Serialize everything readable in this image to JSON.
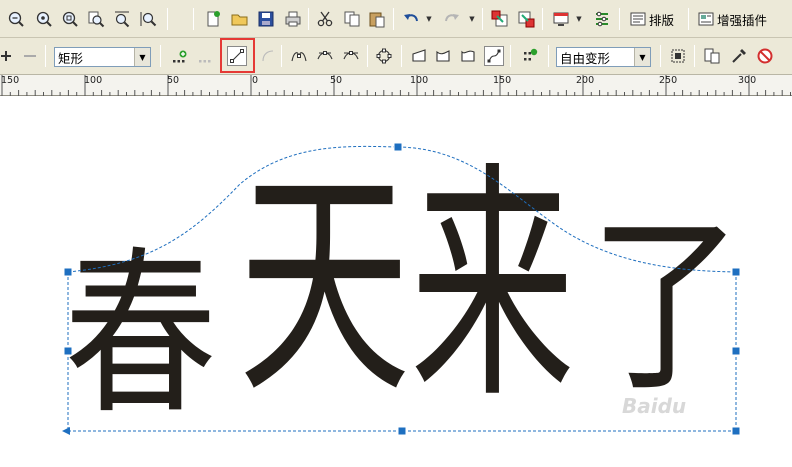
{
  "toolbar_standard": {
    "buttons": [
      {
        "name": "zoom-out-icon"
      },
      {
        "name": "zoom-to-selected-icon"
      },
      {
        "name": "zoom-to-all-icon"
      },
      {
        "name": "zoom-to-page-icon"
      },
      {
        "name": "zoom-to-page-width-icon"
      },
      {
        "name": "zoom-to-page-height-icon"
      },
      {
        "name": "new-document-icon"
      },
      {
        "name": "open-icon"
      },
      {
        "name": "save-icon"
      },
      {
        "name": "print-icon"
      },
      {
        "name": "cut-icon"
      },
      {
        "name": "copy-icon"
      },
      {
        "name": "paste-icon"
      },
      {
        "name": "undo-icon"
      },
      {
        "name": "redo-icon"
      },
      {
        "name": "import-icon"
      },
      {
        "name": "export-icon"
      },
      {
        "name": "application-launcher-icon"
      },
      {
        "name": "options-icon"
      }
    ],
    "layout_label": "排版",
    "plugin_label": "增强插件"
  },
  "property_bar": {
    "shape_combo_value": "矩形",
    "transform_combo_value": "自由变形",
    "buttons": [
      {
        "name": "add-node-icon"
      },
      {
        "name": "delete-node-icon"
      },
      {
        "name": "join-nodes-icon"
      },
      {
        "name": "break-curve-icon"
      },
      {
        "name": "to-line-icon"
      },
      {
        "name": "to-curve-icon"
      },
      {
        "name": "cusp-node-icon"
      },
      {
        "name": "smooth-node-icon"
      },
      {
        "name": "symmetrical-node-icon"
      },
      {
        "name": "reverse-direction-icon"
      },
      {
        "name": "extract-subpath-icon"
      },
      {
        "name": "stretch-nodes-icon"
      },
      {
        "name": "rotate-nodes-icon"
      },
      {
        "name": "align-nodes-icon"
      },
      {
        "name": "envelope-straight-line-icon"
      },
      {
        "name": "envelope-single-arc-icon"
      },
      {
        "name": "envelope-double-arc-icon"
      },
      {
        "name": "envelope-unconstrained-icon"
      },
      {
        "name": "add-preset-icon"
      },
      {
        "name": "create-envelope-from-icon"
      },
      {
        "name": "convert-to-curves-icon"
      },
      {
        "name": "eyedropper-icon"
      },
      {
        "name": "clear-envelope-icon"
      }
    ]
  },
  "ruler": {
    "labels": [
      "150",
      "100",
      "50",
      "0",
      "50",
      "100",
      "150",
      "200",
      "250",
      "300"
    ]
  },
  "canvas": {
    "text": "春天来了",
    "watermark": "Baidu"
  },
  "colors": {
    "text_fill": "#231f1a",
    "envelope_dash": "#1f6fbf",
    "handle_fill": "#1e6fc0",
    "highlight": "#e53935",
    "toolbar_bg": "#ece9d8"
  }
}
